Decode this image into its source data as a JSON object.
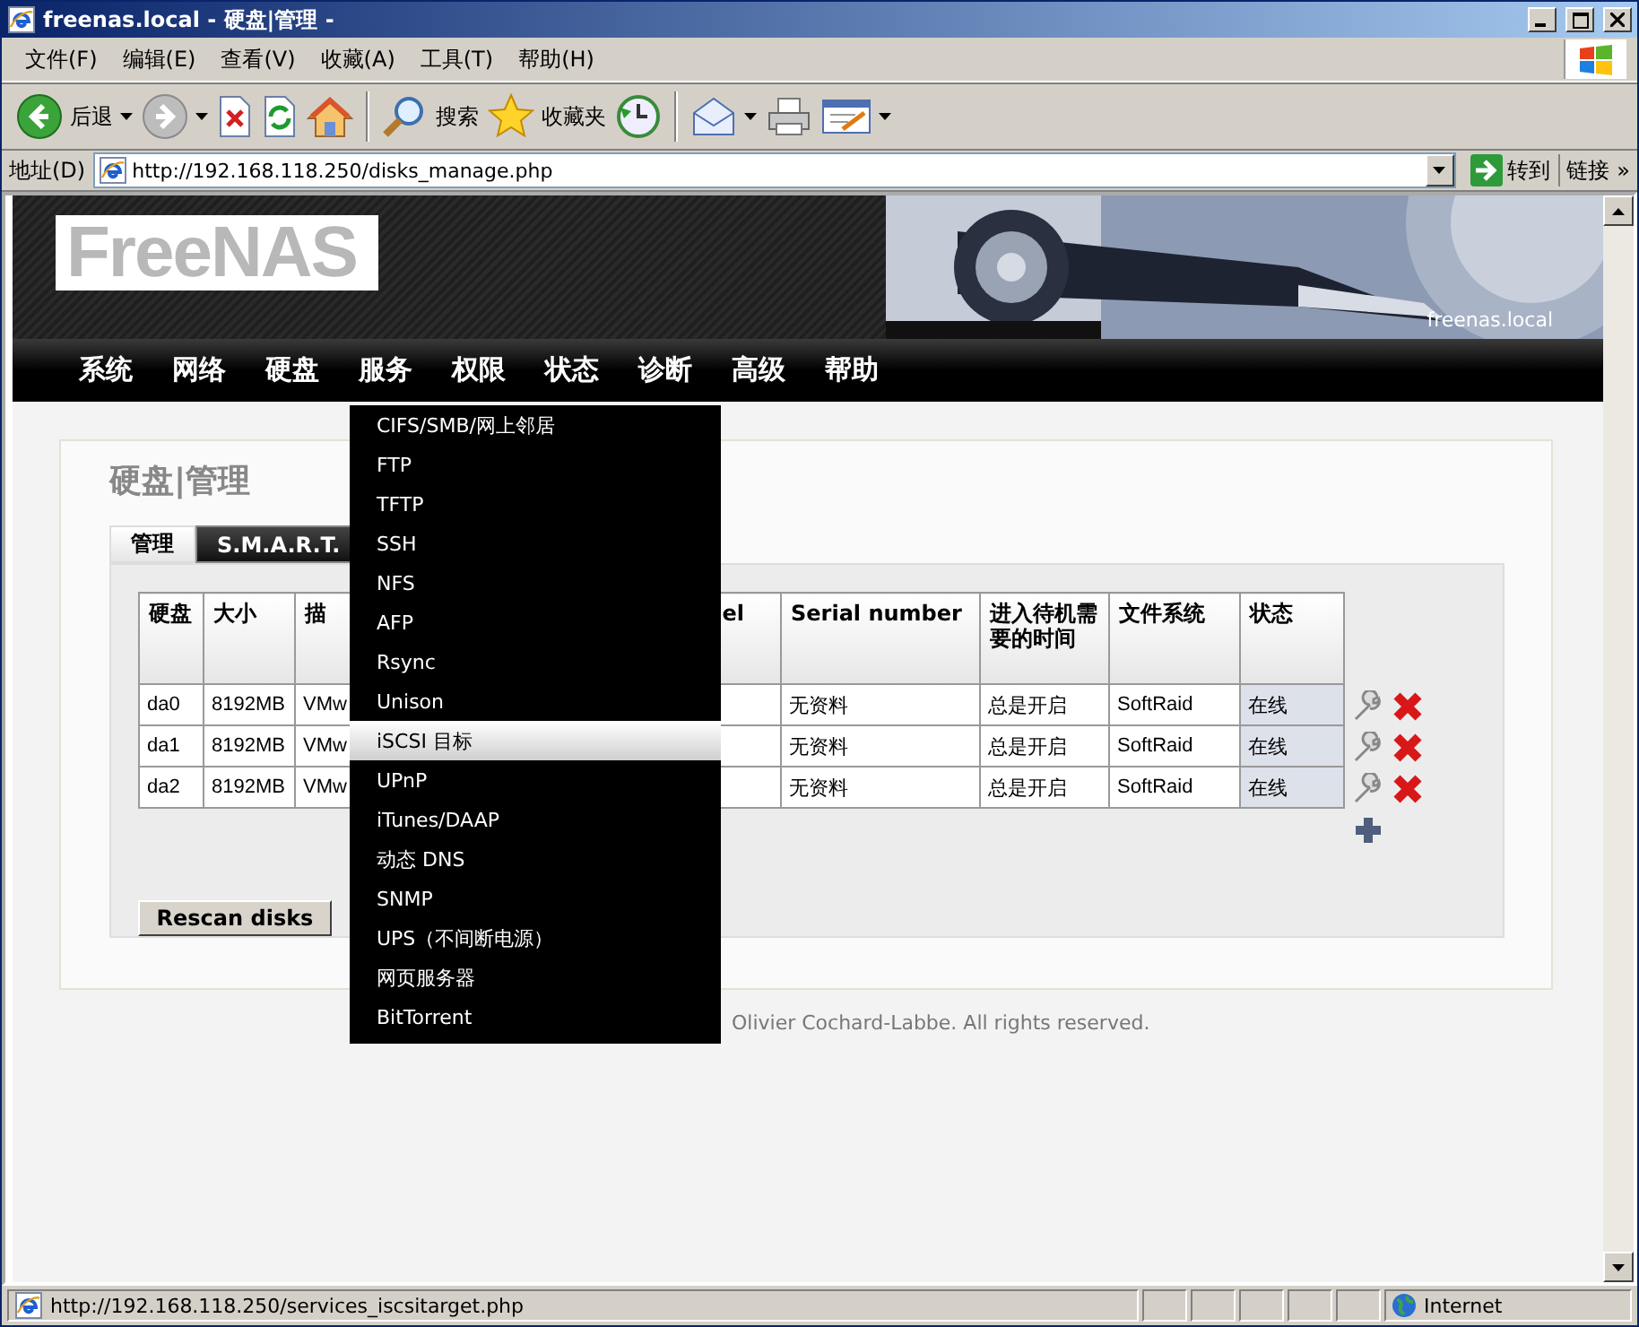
{
  "window": {
    "title": "freenas.local - 硬盘|管理 -"
  },
  "menu_bar": [
    "文件(F)",
    "编辑(E)",
    "查看(V)",
    "收藏(A)",
    "工具(T)",
    "帮助(H)"
  ],
  "toolbar": [
    {
      "kind": "back",
      "label": "后退"
    },
    {
      "kind": "forward"
    },
    {
      "kind": "stop"
    },
    {
      "kind": "refresh"
    },
    {
      "kind": "home"
    },
    {
      "kind": "search",
      "label": "搜索"
    },
    {
      "kind": "favorites",
      "label": "收藏夹"
    },
    {
      "kind": "history"
    },
    {
      "kind": "mail"
    },
    {
      "kind": "print"
    },
    {
      "kind": "edit"
    }
  ],
  "address_bar": {
    "label": "地址(D)",
    "value": "http://192.168.118.250/disks_manage.php",
    "go": "转到",
    "links": "链接",
    "more": "»"
  },
  "page": {
    "logo": "FreeNAS",
    "hostname": "freenas.local",
    "nav": [
      "系统",
      "网络",
      "硬盘",
      "服务",
      "权限",
      "状态",
      "诊断",
      "高级",
      "帮助"
    ],
    "nav_menu": [
      {
        "label": "CIFS/SMB/网上邻居",
        "selected": false
      },
      {
        "label": "FTP",
        "selected": false
      },
      {
        "label": "TFTP",
        "selected": false
      },
      {
        "label": "SSH",
        "selected": false
      },
      {
        "label": "NFS",
        "selected": false
      },
      {
        "label": "AFP",
        "selected": false
      },
      {
        "label": "Rsync",
        "selected": false
      },
      {
        "label": "Unison",
        "selected": false
      },
      {
        "label": "iSCSI 目标",
        "selected": true
      },
      {
        "label": "UPnP",
        "selected": false
      },
      {
        "label": "iTunes/DAAP",
        "selected": false
      },
      {
        "label": "动态 DNS",
        "selected": false
      },
      {
        "label": "SNMP",
        "selected": false
      },
      {
        "label": "UPS（不间断电源）",
        "selected": false
      },
      {
        "label": "网页服务器",
        "selected": false
      },
      {
        "label": "BitTorrent",
        "selected": false
      }
    ],
    "heading": "硬盘|管理",
    "tabs": [
      {
        "label": "管理",
        "selected": true
      },
      {
        "label": "S.M.A.R.T.",
        "selected": false
      }
    ],
    "table": {
      "columns": [
        "硬盘",
        "大小",
        "描",
        "el",
        "Serial number",
        "进入待机需要的时间",
        "文件系统",
        "状态"
      ],
      "rows": [
        {
          "disk": "da0",
          "size": "8192MB",
          "description": "VMw",
          "serial_number": "无资料",
          "standby": "总是开启",
          "file_system": "SoftRaid",
          "status": "在线"
        },
        {
          "disk": "da1",
          "size": "8192MB",
          "description": "VMw",
          "serial_number": "无资料",
          "standby": "总是开启",
          "file_system": "SoftRaid",
          "status": "在线"
        },
        {
          "disk": "da2",
          "size": "8192MB",
          "description": "VMw",
          "serial_number": "无资料",
          "standby": "总是开启",
          "file_system": "SoftRaid",
          "status": "在线"
        }
      ]
    },
    "rescan_button": "Rescan disks",
    "footer": "Olivier Cochard-Labbe. All rights reserved."
  },
  "status_bar": {
    "url": "http://192.168.118.250/services_iscsitarget.php",
    "zone": "Internet"
  }
}
